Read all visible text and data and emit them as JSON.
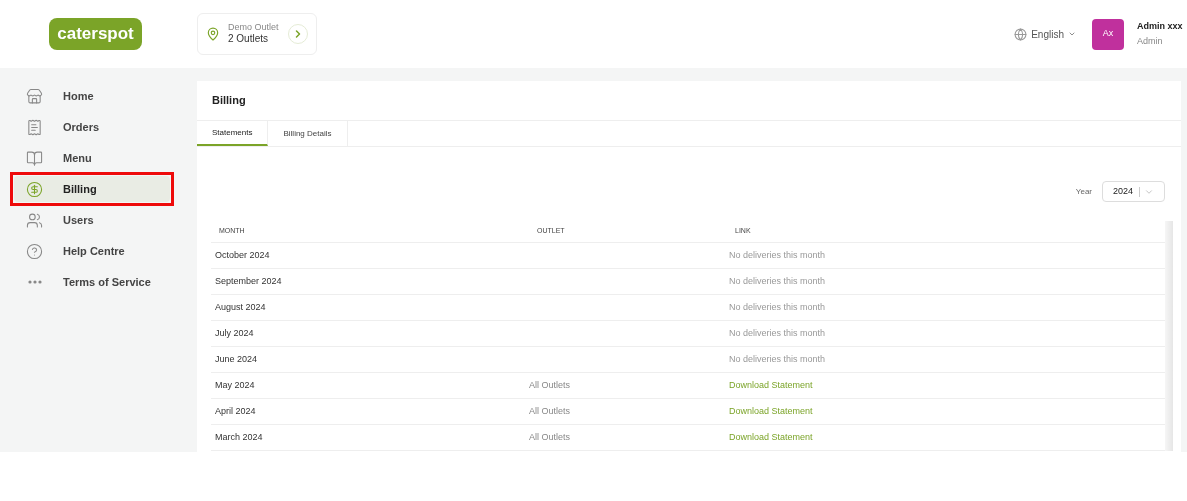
{
  "header": {
    "logo": "caterspot",
    "outlet": {
      "label": "Demo Outlet",
      "value": "2 Outlets"
    },
    "language": "English",
    "user": {
      "initials": "Ax",
      "name": "Admin xxx",
      "role": "Admin"
    }
  },
  "sidebar": {
    "items": [
      {
        "label": "Home",
        "selected": false,
        "annotated": false
      },
      {
        "label": "Orders",
        "selected": false,
        "annotated": false
      },
      {
        "label": "Menu",
        "selected": false,
        "annotated": false
      },
      {
        "label": "Billing",
        "selected": true,
        "annotated": true
      },
      {
        "label": "Users",
        "selected": false,
        "annotated": false
      },
      {
        "label": "Help Centre",
        "selected": false,
        "annotated": false
      },
      {
        "label": "Terms of Service",
        "selected": false,
        "annotated": false
      }
    ]
  },
  "page": {
    "title": "Billing",
    "tabs": [
      {
        "label": "Statements",
        "selected": true
      },
      {
        "label": "Billing Details",
        "selected": false
      }
    ],
    "year_filter": {
      "label": "Year",
      "value": "2024"
    },
    "table": {
      "columns": [
        "MONTH",
        "OUTLET",
        "LINK"
      ],
      "rows": [
        {
          "month": "October 2024",
          "kind": "none",
          "link": "No deliveries this month"
        },
        {
          "month": "September 2024",
          "kind": "none",
          "link": "No deliveries this month"
        },
        {
          "month": "August 2024",
          "kind": "none",
          "link": "No deliveries this month"
        },
        {
          "month": "July 2024",
          "kind": "none",
          "link": "No deliveries this month"
        },
        {
          "month": "June 2024",
          "kind": "none",
          "link": "No deliveries this month"
        },
        {
          "month": "May 2024",
          "outlet": "All Outlets",
          "kind": "download",
          "link": "Download Statement"
        },
        {
          "month": "April 2024",
          "outlet": "All Outlets",
          "kind": "download",
          "link": "Download Statement"
        },
        {
          "month": "March 2024",
          "outlet": "All Outlets",
          "kind": "download",
          "link": "Download Statement"
        }
      ]
    }
  }
}
